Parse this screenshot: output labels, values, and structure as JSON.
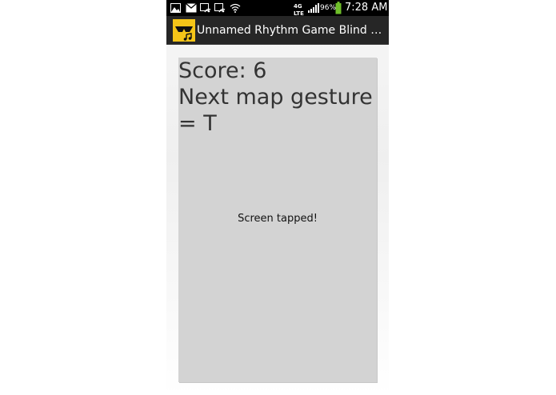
{
  "status_bar": {
    "notification_icons": [
      "gallery-icon",
      "gmail-icon",
      "wifi-notification-icon",
      "wifi-notification-icon",
      "wifi-signal-icon"
    ],
    "network_label": "4G LTE",
    "battery_percent": "96%",
    "battery_level": 0.96,
    "time": "7:28 AM"
  },
  "action_bar": {
    "title": "Unnamed Rhythm Game Blind Accessible",
    "icon": "sunglasses-music-icon",
    "icon_bg": "#f5c518"
  },
  "game": {
    "score_text": "Score: 6",
    "gesture_text": "Next map gesture = T",
    "tap_message": "Screen tapped!",
    "area_color": "#d3d3d3"
  }
}
